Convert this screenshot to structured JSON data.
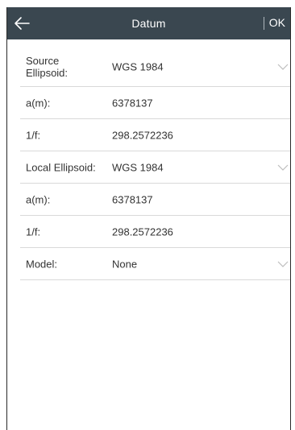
{
  "header": {
    "title": "Datum",
    "ok_label": "OK"
  },
  "icons": {
    "back": "arrow-left-icon",
    "dropdown": "chevron-down-icon"
  },
  "colors": {
    "appbar": "#3a4750",
    "text": "#333333",
    "divider": "#d9d9d9",
    "chevron": "#bdbdbd"
  },
  "form": {
    "source_ellipsoid": {
      "label": "Source Ellipsoid:",
      "value": "WGS 1984"
    },
    "source_a": {
      "label": "a(m):",
      "value": "6378137"
    },
    "source_f": {
      "label": "1/f:",
      "value": "298.2572236"
    },
    "local_ellipsoid": {
      "label": "Local Ellipsoid:",
      "value": "WGS 1984"
    },
    "local_a": {
      "label": "a(m):",
      "value": "6378137"
    },
    "local_f": {
      "label": "1/f:",
      "value": "298.2572236"
    },
    "model": {
      "label": "Model:",
      "value": "None"
    }
  }
}
